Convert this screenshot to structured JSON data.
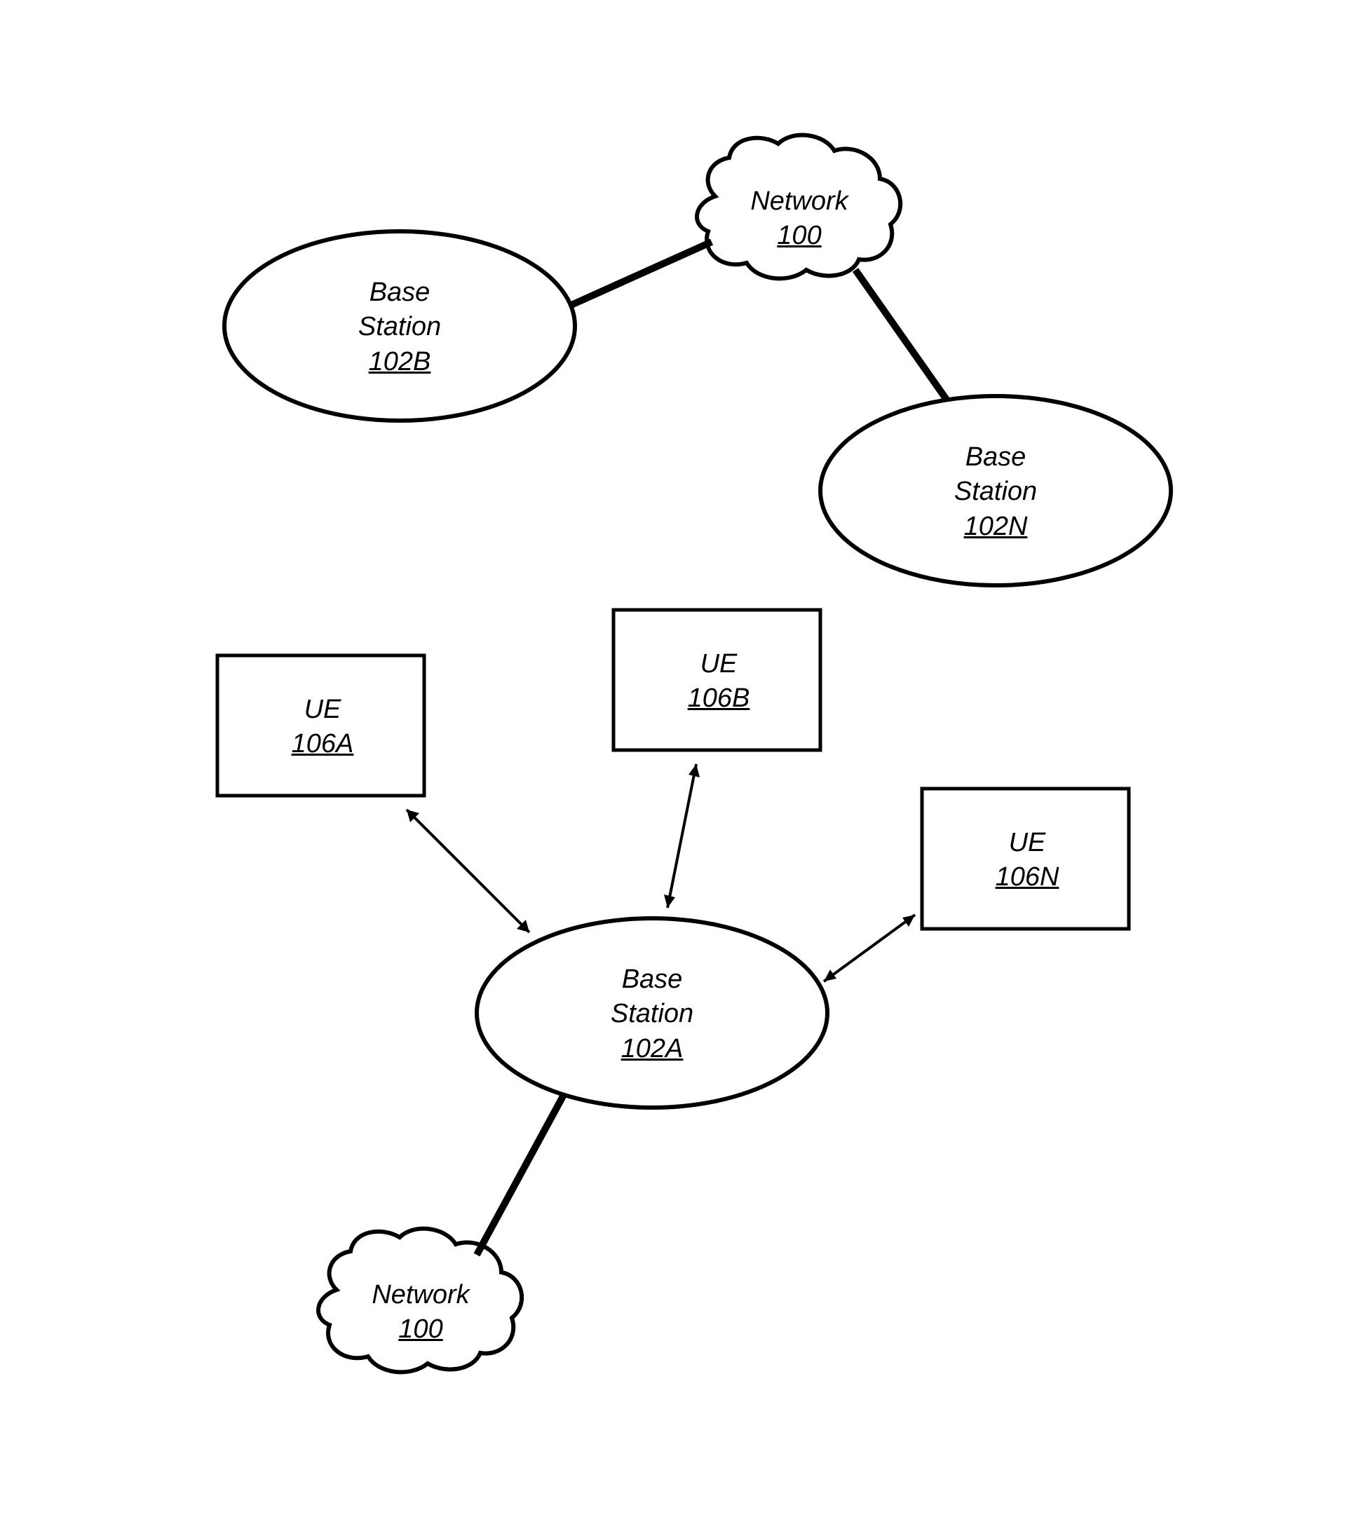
{
  "diagram": {
    "network1": {
      "label": "Network",
      "ref": "100"
    },
    "network2": {
      "label": "Network",
      "ref": "100"
    },
    "baseStation102B": {
      "label": "Base",
      "label2": "Station",
      "ref": "102B"
    },
    "baseStation102N": {
      "label": "Base",
      "label2": "Station",
      "ref": "102N"
    },
    "baseStation102A": {
      "label": "Base",
      "label2": "Station",
      "ref": "102A"
    },
    "ue106A": {
      "label": "UE",
      "ref": "106A"
    },
    "ue106B": {
      "label": "UE",
      "ref": "106B"
    },
    "ue106N": {
      "label": "UE",
      "ref": "106N"
    }
  }
}
